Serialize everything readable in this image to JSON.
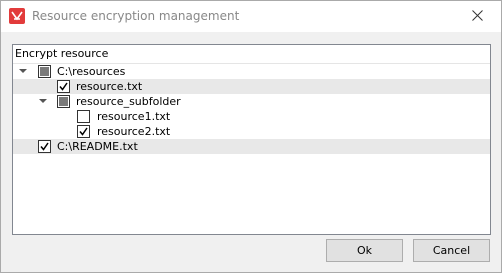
{
  "window": {
    "title": "Resource encryption management",
    "accent_color": "#e23b3b"
  },
  "tree": {
    "header": "Encrypt resource",
    "items": [
      {
        "label": "C:\\resources",
        "state": "partial",
        "expanded": true
      },
      {
        "label": "resource.txt",
        "state": "checked"
      },
      {
        "label": "resource_subfolder",
        "state": "partial",
        "expanded": true
      },
      {
        "label": "resource1.txt",
        "state": "unchecked"
      },
      {
        "label": "resource2.txt",
        "state": "checked"
      },
      {
        "label": "C:\\README.txt",
        "state": "checked"
      }
    ]
  },
  "buttons": {
    "ok": "Ok",
    "cancel": "Cancel"
  }
}
